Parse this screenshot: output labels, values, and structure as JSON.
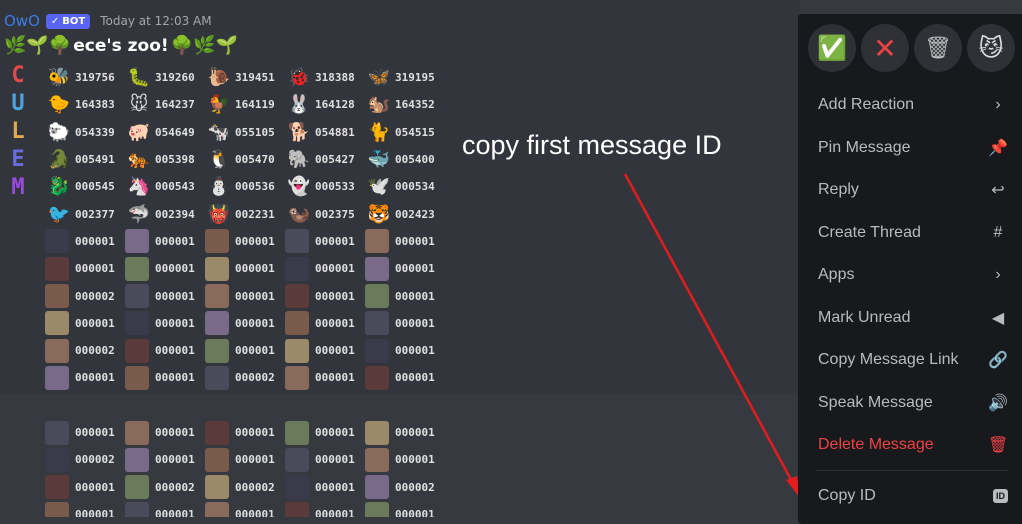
{
  "message": {
    "author": "OwO",
    "bot_tag": "BOT",
    "bot_check": "✓",
    "timestamp": "Today at 12:03 AM",
    "title": "ece's zoo!",
    "title_left_emojis": "🌿🌱🌳",
    "title_right_emojis": "🌳🌿🌱",
    "letters": [
      "C",
      "U",
      "L",
      "E",
      "M"
    ],
    "zoo_rows": [
      [
        {
          "e": "🐝",
          "n": "319756"
        },
        {
          "e": "🐛",
          "n": "319260"
        },
        {
          "e": "🐌",
          "n": "319451"
        },
        {
          "e": "🐞",
          "n": "318388"
        },
        {
          "e": "🦋",
          "n": "319195"
        }
      ],
      [
        {
          "e": "🐤",
          "n": "164383"
        },
        {
          "e": "🐭",
          "n": "164237"
        },
        {
          "e": "🐓",
          "n": "164119"
        },
        {
          "e": "🐰",
          "n": "164128"
        },
        {
          "e": "🐿️",
          "n": "164352"
        }
      ],
      [
        {
          "e": "🐑",
          "n": "054339"
        },
        {
          "e": "🐖",
          "n": "054649"
        },
        {
          "e": "🐄",
          "n": "055105"
        },
        {
          "e": "🐕",
          "n": "054881"
        },
        {
          "e": "🐈",
          "n": "054515"
        }
      ],
      [
        {
          "e": "🐊",
          "n": "005491"
        },
        {
          "e": "🐅",
          "n": "005398"
        },
        {
          "e": "🐧",
          "n": "005470"
        },
        {
          "e": "🐘",
          "n": "005427"
        },
        {
          "e": "🐳",
          "n": "005400"
        }
      ],
      [
        {
          "e": "🐉",
          "n": "000545"
        },
        {
          "e": "🦄",
          "n": "000543"
        },
        {
          "e": "⛄",
          "n": "000536"
        },
        {
          "e": "👻",
          "n": "000533"
        },
        {
          "e": "🕊️",
          "n": "000534"
        }
      ],
      [
        {
          "e": "🐦",
          "n": "002377"
        },
        {
          "e": "🦈",
          "n": "002394"
        },
        {
          "e": "👹",
          "n": "002231"
        },
        {
          "e": "🦦",
          "n": "002375"
        },
        {
          "e": "🐯",
          "n": "002423"
        }
      ],
      [
        {
          "e": "",
          "n": "000001"
        },
        {
          "e": "",
          "n": "000001"
        },
        {
          "e": "",
          "n": "000001"
        },
        {
          "e": "",
          "n": "000001"
        },
        {
          "e": "",
          "n": "000001"
        }
      ],
      [
        {
          "e": "",
          "n": "000001"
        },
        {
          "e": "",
          "n": "000001"
        },
        {
          "e": "",
          "n": "000001"
        },
        {
          "e": "",
          "n": "000001"
        },
        {
          "e": "",
          "n": "000001"
        }
      ],
      [
        {
          "e": "",
          "n": "000002"
        },
        {
          "e": "",
          "n": "000001"
        },
        {
          "e": "",
          "n": "000001"
        },
        {
          "e": "",
          "n": "000001"
        },
        {
          "e": "",
          "n": "000001"
        }
      ],
      [
        {
          "e": "",
          "n": "000001"
        },
        {
          "e": "",
          "n": "000001"
        },
        {
          "e": "",
          "n": "000001"
        },
        {
          "e": "",
          "n": "000001"
        },
        {
          "e": "",
          "n": "000001"
        }
      ],
      [
        {
          "e": "",
          "n": "000002"
        },
        {
          "e": "",
          "n": "000001"
        },
        {
          "e": "",
          "n": "000001"
        },
        {
          "e": "",
          "n": "000001"
        },
        {
          "e": "",
          "n": "000001"
        }
      ],
      [
        {
          "e": "",
          "n": "000001"
        },
        {
          "e": "",
          "n": "000001"
        },
        {
          "e": "",
          "n": "000002"
        },
        {
          "e": "",
          "n": "000001"
        },
        {
          "e": "",
          "n": "000001"
        }
      ],
      [
        {
          "e": "",
          "n": ""
        },
        {
          "e": "",
          "n": ""
        },
        {
          "e": "",
          "n": ""
        },
        {
          "e": "",
          "n": ""
        },
        {
          "e": "",
          "n": ""
        }
      ],
      [
        {
          "e": "",
          "n": "000001"
        },
        {
          "e": "",
          "n": "000001"
        },
        {
          "e": "",
          "n": "000001"
        },
        {
          "e": "",
          "n": "000001"
        },
        {
          "e": "",
          "n": "000001"
        }
      ],
      [
        {
          "e": "",
          "n": "000002"
        },
        {
          "e": "",
          "n": "000001"
        },
        {
          "e": "",
          "n": "000001"
        },
        {
          "e": "",
          "n": "000001"
        },
        {
          "e": "",
          "n": "000001"
        }
      ],
      [
        {
          "e": "",
          "n": "000001"
        },
        {
          "e": "",
          "n": "000002"
        },
        {
          "e": "",
          "n": "000002"
        },
        {
          "e": "",
          "n": "000001"
        },
        {
          "e": "",
          "n": "000002"
        }
      ],
      [
        {
          "e": "",
          "n": "000001"
        },
        {
          "e": "",
          "n": "000001"
        },
        {
          "e": "",
          "n": "000001"
        },
        {
          "e": "",
          "n": "000001"
        },
        {
          "e": "",
          "n": "000001"
        }
      ]
    ]
  },
  "annotation": "copy first message ID",
  "context_menu": {
    "quick_reacts": [
      {
        "icon": "✅",
        "name": "check-mark-react"
      },
      {
        "icon": "✕",
        "name": "cross-mark-react"
      },
      {
        "icon": "🗑",
        "name": "wastebasket-react"
      },
      {
        "icon": "😼",
        "name": "smirk-cat-react"
      }
    ],
    "items": [
      {
        "label": "Add Reaction",
        "icon": "›",
        "icon_name": "chevron-right-icon",
        "danger": false
      },
      {
        "label": "Pin Message",
        "icon": "📌",
        "icon_name": "pin-icon",
        "danger": false
      },
      {
        "label": "Reply",
        "icon": "↩",
        "icon_name": "reply-icon",
        "danger": false
      },
      {
        "label": "Create Thread",
        "icon": "#",
        "icon_name": "thread-icon",
        "danger": false
      },
      {
        "label": "Apps",
        "icon": "›",
        "icon_name": "chevron-right-icon",
        "danger": false
      },
      {
        "label": "Mark Unread",
        "icon": "◀",
        "icon_name": "mark-unread-icon",
        "danger": false
      },
      {
        "label": "Copy Message Link",
        "icon": "🔗",
        "icon_name": "link-icon",
        "danger": false
      },
      {
        "label": "Speak Message",
        "icon": "🔊",
        "icon_name": "speak-icon",
        "danger": false
      },
      {
        "label": "Delete Message",
        "icon": "🗑",
        "icon_name": "trash-icon",
        "danger": true
      },
      {
        "label": "Copy ID",
        "icon": "ID",
        "icon_name": "id-icon",
        "danger": false
      }
    ]
  },
  "colors": {
    "background": "#36393f",
    "menu_bg": "#18191c",
    "danger": "#ed4245",
    "author": "#3b7ee8",
    "bot_tag": "#5865f2",
    "arrow": "#e11d1d"
  }
}
